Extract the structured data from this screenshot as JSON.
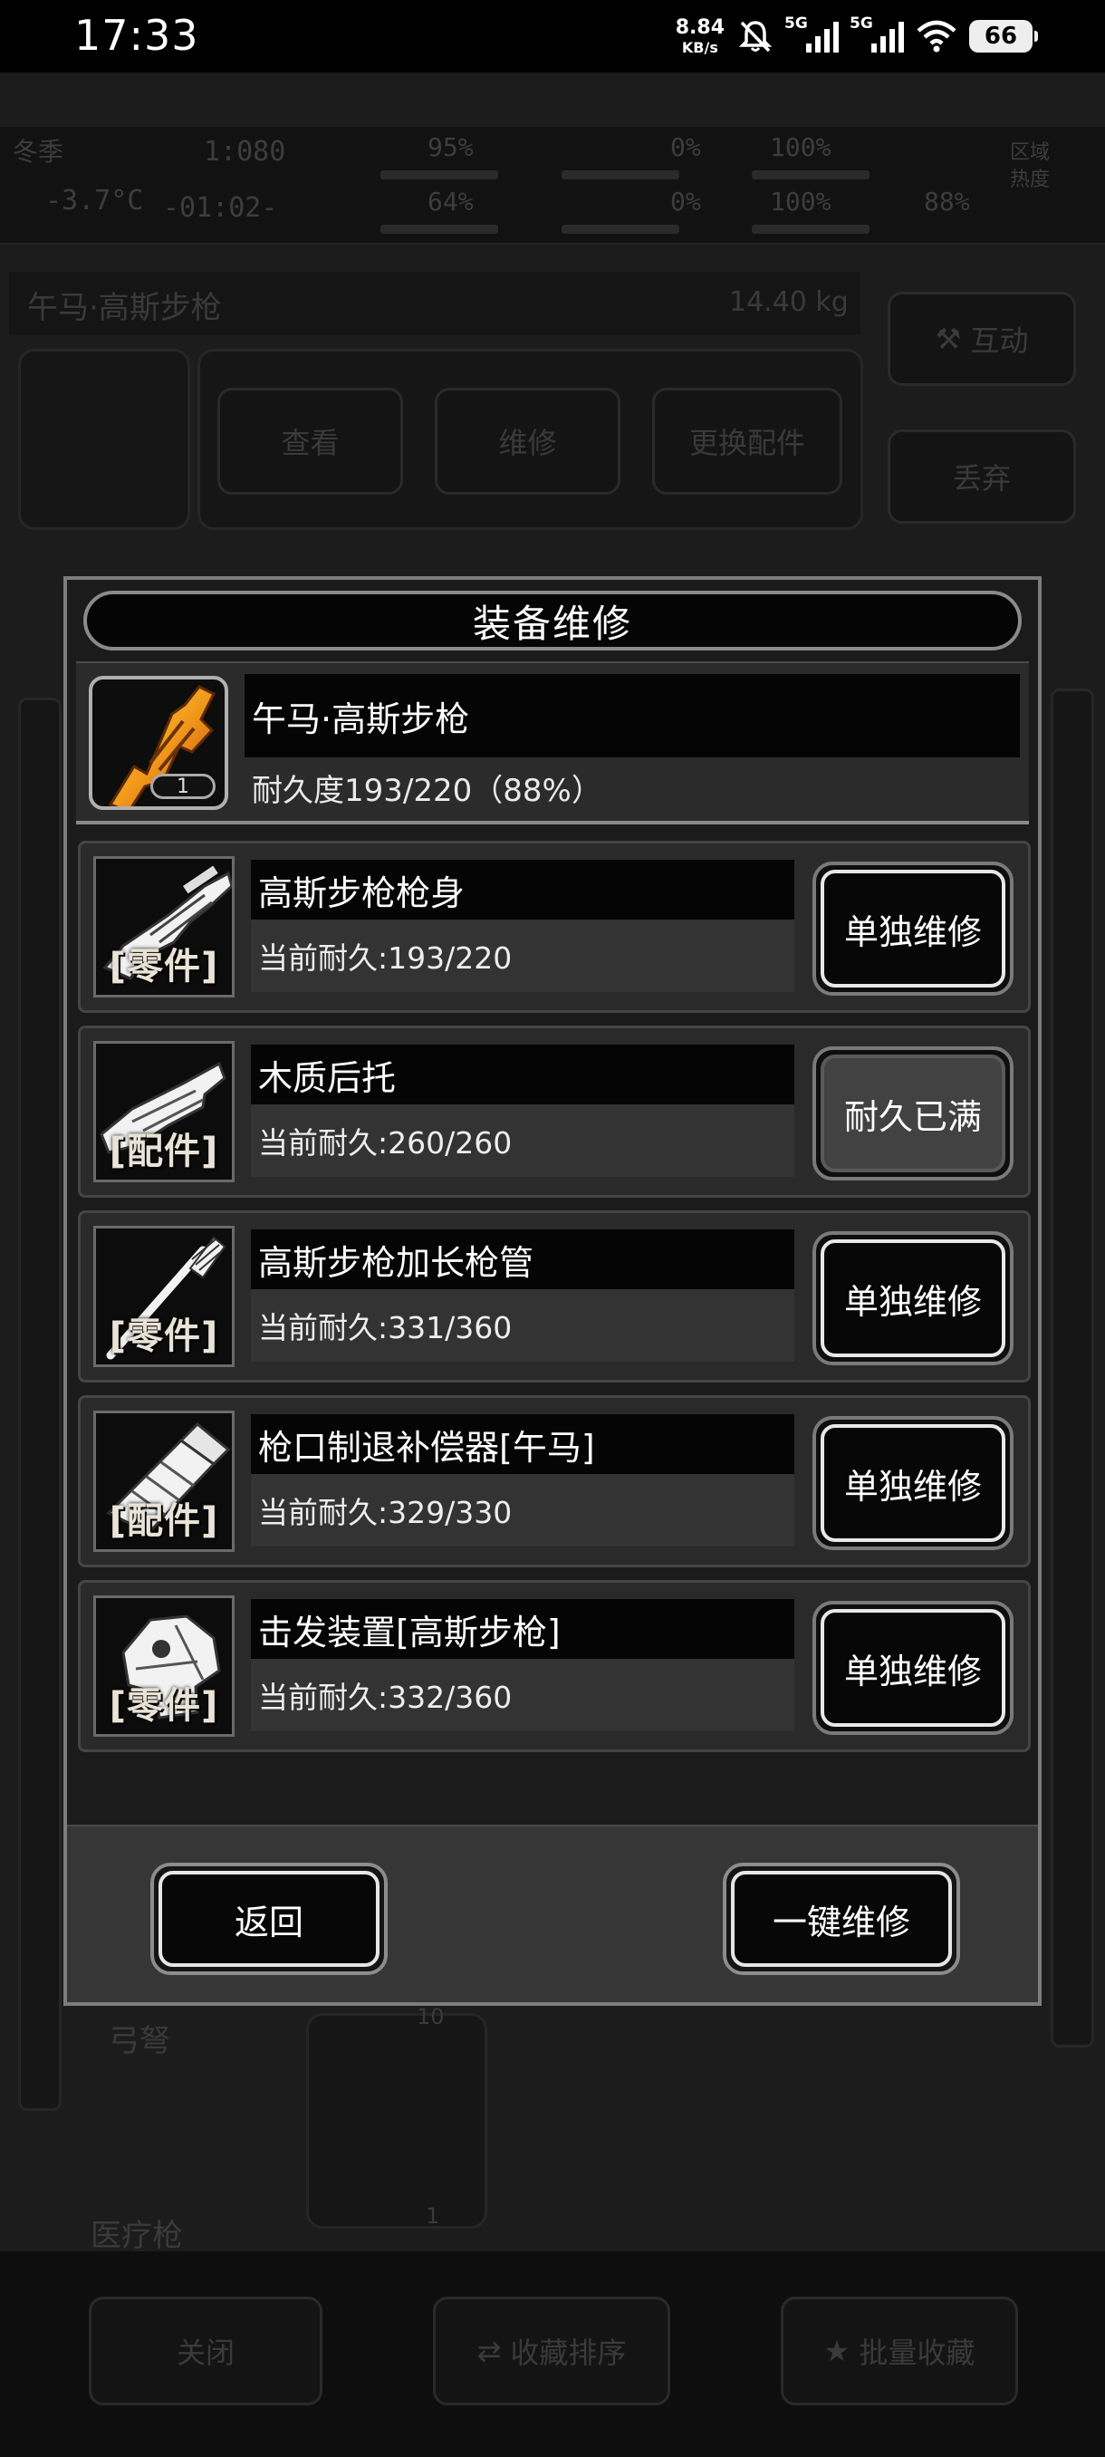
{
  "status_bar": {
    "time": "17:33",
    "net_speed": "8.84",
    "net_speed_unit": "KB/s",
    "sim1": "5G",
    "sim2": "5G",
    "battery": "66"
  },
  "background": {
    "hud": {
      "season": "冬季",
      "temperature": "-3.7°C",
      "clock": "1:080",
      "timer": "-01:02-",
      "stat1": "95%",
      "stat2": "64%",
      "stat3": "0%",
      "stat4": "0%",
      "stat5": "100%",
      "stat6": "100%",
      "stat7": "88%",
      "zone_heat": "区域热度"
    },
    "item_title": "午马·高斯步枪",
    "item_weight": "14.40 kg",
    "btn_view": "查看",
    "btn_repair": "维修",
    "btn_swap": "更换配件",
    "btn_interact": "互动",
    "btn_discard": "丢弃",
    "side_crossbow": "弓弩",
    "side_medgun": "医疗枪",
    "stack_count": "10",
    "slot_count": "1",
    "btn_close": "关闭",
    "btn_sort": "收藏排序",
    "btn_batch": "批量收藏"
  },
  "modal": {
    "title": "装备维修",
    "item": {
      "name": "午马·高斯步枪",
      "durability": "耐久度193/220（88%）",
      "count": "1"
    },
    "parts": [
      {
        "name": "高斯步枪枪身",
        "durability": "当前耐久:193/220",
        "tag": "零件",
        "button": "单独维修",
        "icon": "rifle-body-icon"
      },
      {
        "name": "木质后托",
        "durability": "当前耐久:260/260",
        "tag": "配件",
        "button": "耐久已满",
        "icon": "wooden-stock-icon"
      },
      {
        "name": "高斯步枪加长枪管",
        "durability": "当前耐久:331/360",
        "tag": "零件",
        "button": "单独维修",
        "icon": "barrel-icon"
      },
      {
        "name": "枪口制退补偿器[午马]",
        "durability": "当前耐久:329/330",
        "tag": "配件",
        "button": "单独维修",
        "icon": "muzzle-brake-icon"
      },
      {
        "name": "击发装置[高斯步枪]",
        "durability": "当前耐久:332/360",
        "tag": "零件",
        "button": "单独维修",
        "icon": "firing-mechanism-icon"
      }
    ],
    "back_button": "返回",
    "repair_all_button": "一键维修"
  }
}
